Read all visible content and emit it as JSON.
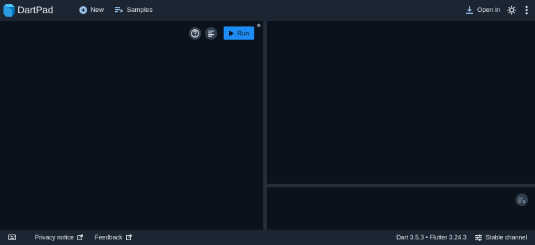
{
  "header": {
    "app_title": "DartPad",
    "new_label": "New",
    "samples_label": "Samples",
    "open_in_label": "Open in"
  },
  "editor": {
    "run_label": "Run"
  },
  "footer": {
    "privacy_label": "Privacy notice",
    "feedback_label": "Feedback",
    "version_text": "Dart 3.5.3 • Flutter 3.24.3",
    "channel_label": "Stable channel"
  },
  "icons": {
    "logo": "dart-logo-icon",
    "new": "add-circle-icon",
    "samples": "playlist-icon",
    "open_in": "download-icon",
    "theme": "brightness-icon",
    "more": "more-vert-icon",
    "help": "help-icon",
    "format": "format-align-icon",
    "run": "play-icon",
    "clear": "clear-all-icon",
    "keyboard": "keyboard-icon",
    "external": "open-in-new-icon",
    "channel": "tune-icon"
  },
  "colors": {
    "accent": "#1d8df5",
    "topbar": "#1c2633",
    "background": "#0b121b"
  }
}
